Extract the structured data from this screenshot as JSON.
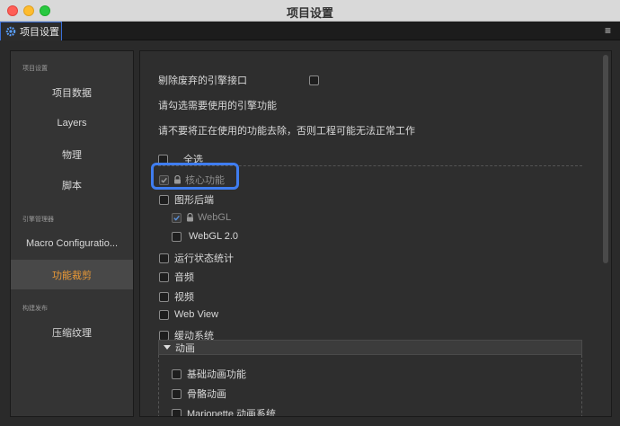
{
  "window": {
    "title": "项目设置"
  },
  "tab": {
    "label": "项目设置",
    "menu_glyph": "≡"
  },
  "sidebar": {
    "sections": [
      {
        "label": "项目设置",
        "items": [
          "项目数据",
          "Layers",
          "物理",
          "脚本"
        ]
      },
      {
        "label": "引擎管理器",
        "items": [
          "Macro Configuratio...",
          "功能裁剪"
        ]
      },
      {
        "label": "构建发布",
        "items": [
          "压缩纹理"
        ]
      }
    ],
    "active_item": "功能裁剪"
  },
  "content": {
    "remove_deprecated_label": "剔除废弃的引擎接口",
    "remove_deprecated_checked": false,
    "instruction": "请勾选需要使用的引擎功能",
    "warning": "请不要将正在使用的功能去除，否则工程可能无法正常工作",
    "select_all": "全选",
    "features": [
      {
        "label": "核心功能",
        "checked": true,
        "locked": true,
        "indent": 0
      },
      {
        "label": "图形后端",
        "checked": false,
        "locked": false,
        "indent": 0
      },
      {
        "label": "WebGL",
        "checked": true,
        "locked": true,
        "indent": 1
      },
      {
        "label": "WebGL 2.0",
        "checked": false,
        "locked": false,
        "indent": 1
      },
      {
        "label": "运行状态统计",
        "checked": false,
        "locked": false,
        "indent": 0
      },
      {
        "label": "音频",
        "checked": false,
        "locked": false,
        "indent": 0
      },
      {
        "label": "视频",
        "checked": false,
        "locked": false,
        "indent": 0
      },
      {
        "label": "Web View",
        "checked": false,
        "locked": false,
        "indent": 0
      },
      {
        "label": "缓动系统",
        "checked": false,
        "locked": false,
        "indent": 0
      }
    ],
    "animation_group": {
      "label": "动画",
      "items": [
        "基础动画功能",
        "骨骼动画",
        "Marionette 动画系统"
      ]
    }
  },
  "colors": {
    "accent": "#3f7df0",
    "active_nav": "#ec9a36"
  }
}
